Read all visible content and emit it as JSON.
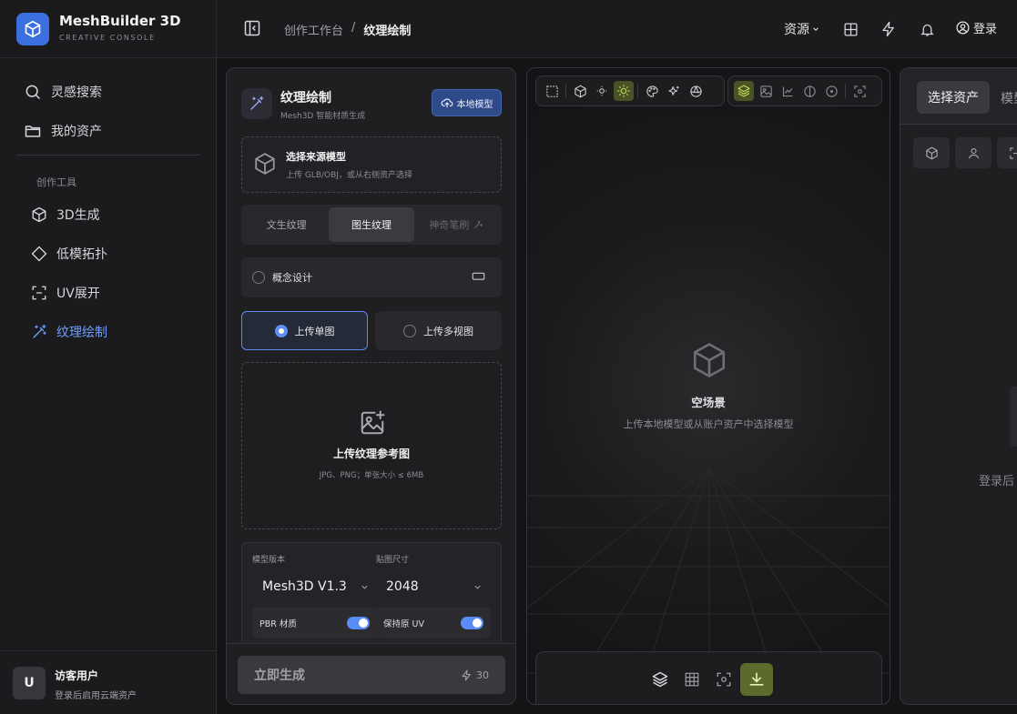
{
  "brand": {
    "name": "MeshBuilder 3D",
    "subtitle": "CREATIVE CONSOLE"
  },
  "sidebar": {
    "items": [
      {
        "label": "灵感搜索",
        "icon": "search-icon"
      },
      {
        "label": "我的资产",
        "icon": "folder-icon"
      }
    ],
    "section_label": "创作工具",
    "tools": [
      {
        "label": "3D生成",
        "icon": "cube-icon",
        "active": false
      },
      {
        "label": "低模拓扑",
        "icon": "diamond-icon",
        "active": false
      },
      {
        "label": "UV展开",
        "icon": "uv-frame-icon",
        "active": false
      },
      {
        "label": "纹理绘制",
        "icon": "magic-wand-icon",
        "active": true
      }
    ],
    "user": {
      "initial": "U",
      "name": "访客用户",
      "hint": "登录后启用云端资产"
    }
  },
  "topbar": {
    "breadcrumb": {
      "parent": "创作工作台",
      "separator": "/",
      "current": "纹理绘制"
    },
    "resource_menu": "资源",
    "login": "登录"
  },
  "panel": {
    "title": "纹理绘制",
    "subtitle": "Mesh3D 智能材质生成",
    "local_model_button": "本地模型",
    "source": {
      "title": "选择来源模型",
      "desc": "上传 GLB/OBJ，或从右侧资产选择"
    },
    "mode_tabs": [
      {
        "label": "文生纹理",
        "state": "normal"
      },
      {
        "label": "图生纹理",
        "state": "active"
      },
      {
        "label": "神奇笔刷",
        "state": "disabled"
      }
    ],
    "concept_label": "概念设计",
    "upload_options": {
      "single": "上传单图",
      "multi": "上传多视图"
    },
    "upload_zone": {
      "title": "上传纹理参考图",
      "desc": "JPG、PNG；单张大小 ≤ 6MB"
    },
    "params": {
      "model_version_label": "模型版本",
      "model_version_value": "Mesh3D V1.3",
      "texture_size_label": "贴图尺寸",
      "texture_size_value": "2048",
      "pbr_label": "PBR 材质",
      "pbr_on": true,
      "keep_uv_label": "保持原 UV",
      "keep_uv_on": true
    },
    "generate": {
      "label": "立即生成",
      "cost": "30"
    }
  },
  "viewport": {
    "empty_title": "空场景",
    "empty_desc": "上传本地模型或从账户资产中选择模型"
  },
  "right_panel": {
    "tabs": {
      "select": "选择资产",
      "model": "模型"
    },
    "login_hint": "登录后"
  },
  "colors": {
    "accent": "#5a8cf6",
    "brand": "#3c6fe0",
    "highlight": "#a8c84a",
    "download_bg": "#5c6a2c"
  }
}
